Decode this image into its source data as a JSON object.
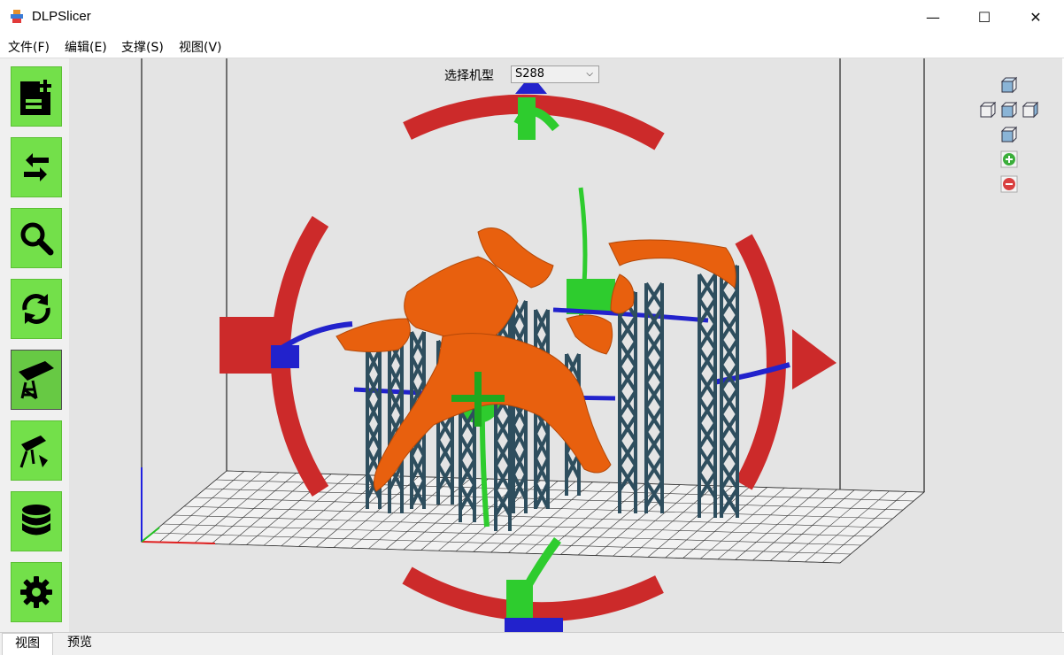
{
  "window": {
    "title": "DLPSlicer",
    "minimize_glyph": "—",
    "maximize_glyph": "☐",
    "close_glyph": "✕"
  },
  "menu": {
    "items": [
      "文件(F)",
      "编辑(E)",
      "支撑(S)",
      "视图(V)"
    ]
  },
  "sidebar": {
    "tools": [
      {
        "name": "new-file",
        "icon": "file-add-icon"
      },
      {
        "name": "import-export",
        "icon": "arrows-exchange-icon"
      },
      {
        "name": "zoom",
        "icon": "magnifier-icon"
      },
      {
        "name": "rotate",
        "icon": "refresh-icon"
      },
      {
        "name": "support-edit",
        "icon": "support-beam-icon",
        "active": true
      },
      {
        "name": "auto-support",
        "icon": "support-auto-icon"
      },
      {
        "name": "layers",
        "icon": "database-layers-icon"
      },
      {
        "name": "settings",
        "icon": "gear-icon"
      }
    ]
  },
  "viewport": {
    "machine_label": "选择机型",
    "machine_value": "S288",
    "model_color": "#e8600e",
    "support_color": "#2e4e5e",
    "ring_red": "#cc2a2a",
    "ring_green": "#2ecc2e",
    "ring_blue": "#2222cc"
  },
  "tabs": {
    "view": "视图",
    "preview": "预览"
  }
}
